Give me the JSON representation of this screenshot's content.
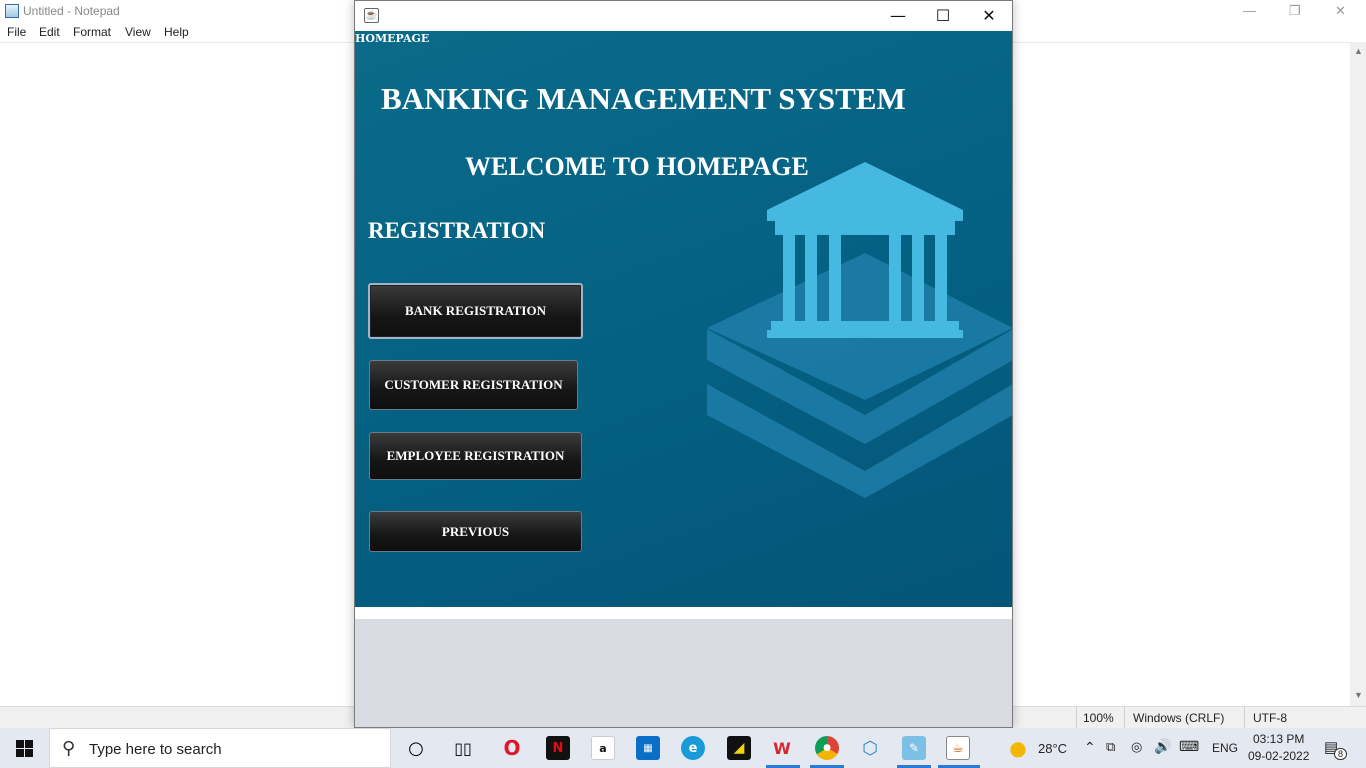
{
  "notepad": {
    "title": "Untitled - Notepad",
    "menu": [
      "File",
      "Edit",
      "Format",
      "View",
      "Help"
    ],
    "status": {
      "zoom": "100%",
      "line_ending": "Windows (CRLF)",
      "encoding": "UTF-8"
    },
    "controls": {
      "minimize": "—",
      "restore": "❐",
      "close": "✕"
    }
  },
  "java_window": {
    "icon": "java-icon",
    "controls": {
      "minimize": "—",
      "maximize": "☐",
      "close": "✕"
    },
    "frame_label": "HOMEPAGE",
    "title": "BANKING MANAGEMENT SYSTEM",
    "welcome": "WELCOME TO HOMEPAGE",
    "section": "REGISTRATION",
    "buttons": {
      "bank": "BANK REGISTRATION",
      "customer": "CUSTOMER REGISTRATION",
      "employee": "EMPLOYEE REGISTRATION",
      "previous": "PREVIOUS"
    },
    "graphic_icon": "bank-building-icon",
    "colors": {
      "panel": "#05688a",
      "button": "#1b1b1b",
      "bank_graphic": "#46b9e1"
    }
  },
  "taskbar": {
    "search_placeholder": "Type here to search",
    "apps": [
      "cortana-icon",
      "task-view-icon",
      "opera-icon",
      "netflix-icon",
      "amazon-icon",
      "microsoft-store-icon",
      "edge-icon",
      "sticky-notes-icon",
      "wps-office-icon",
      "chrome-icon",
      "netbeans-icon",
      "notepad-icon",
      "java-icon"
    ],
    "weather": "28°C",
    "language": "ENG",
    "time": "03:13 PM",
    "date": "09-02-2022",
    "notification_count": "8"
  }
}
